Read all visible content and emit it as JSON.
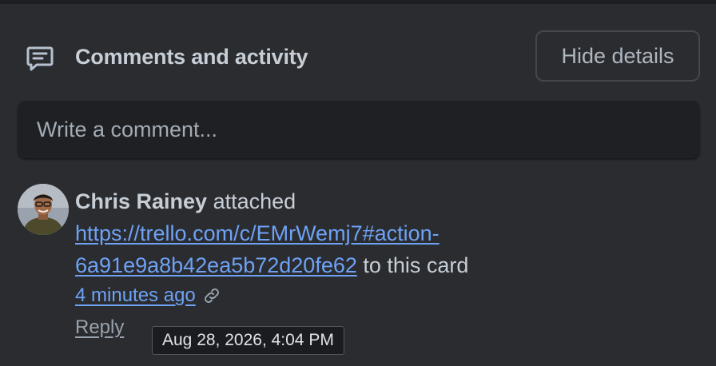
{
  "header": {
    "title": "Comments and activity",
    "icon": "comment-icon",
    "hide_details_label": "Hide details"
  },
  "comment_box": {
    "placeholder": "Write a comment..."
  },
  "activity": {
    "author": "Chris Rainey",
    "action": " attached ",
    "link_text": "https://trello.com/c/EMrWemj7#action-6a91e9a8b42ea5b72d20fe62",
    "suffix": " to this card",
    "timestamp": "4 minutes ago",
    "link_icon": "link-icon",
    "reply_label": "Reply"
  },
  "tooltip": {
    "text": "Aug 28, 2026, 4:04 PM"
  },
  "colors": {
    "background": "#2b2c30",
    "input_background": "#1f2023",
    "link": "#6ea2f5",
    "text": "#c7ced6"
  }
}
